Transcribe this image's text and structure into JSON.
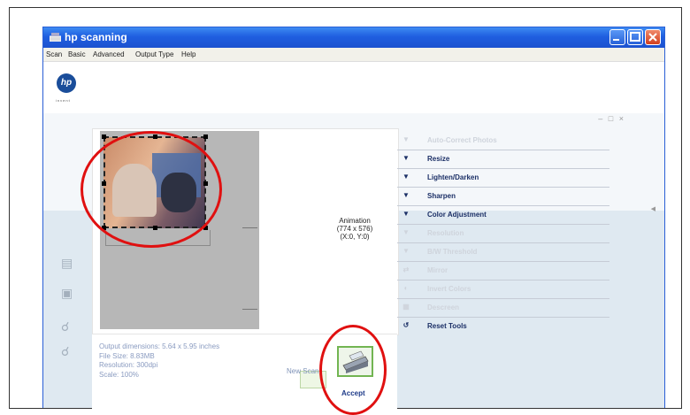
{
  "window": {
    "title": "hp scanning"
  },
  "menu": [
    "Scan",
    "Basic",
    "Advanced",
    "Output Type",
    "Help"
  ],
  "brand": {
    "logo_text": "hp",
    "logo_sub": "invent"
  },
  "panel_controls": "– □ ×",
  "preview": {
    "label_line1": "Animation",
    "label_line2": "(774 x 576)",
    "label_line3": "(X:0, Y:0)"
  },
  "tools": [
    {
      "label": "Auto-Correct Photos",
      "icon": "chevron-down-icon",
      "enabled": false
    },
    {
      "label": "Resize",
      "icon": "chevron-down-icon",
      "enabled": true
    },
    {
      "label": "Lighten/Darken",
      "icon": "chevron-down-icon",
      "enabled": true
    },
    {
      "label": "Sharpen",
      "icon": "chevron-down-icon",
      "enabled": true
    },
    {
      "label": "Color Adjustment",
      "icon": "chevron-down-icon",
      "enabled": true
    },
    {
      "label": "Resolution",
      "icon": "chevron-down-icon",
      "enabled": false
    },
    {
      "label": "B/W Threshold",
      "icon": "chevron-down-icon",
      "enabled": false
    },
    {
      "label": "Mirror",
      "icon": "mirror-icon",
      "enabled": false
    },
    {
      "label": "Invert Colors",
      "icon": "invert-icon",
      "enabled": false
    },
    {
      "label": "Descreen",
      "icon": "descreen-icon",
      "enabled": false
    },
    {
      "label": "Reset Tools",
      "icon": "reset-icon",
      "enabled": true
    }
  ],
  "info": {
    "output_dimensions": "Output dimensions: 5.64 x 5.95 inches",
    "file_size": "File Size: 8.83MB",
    "resolution": "Resolution: 300dpi",
    "scale": "Scale: 100%"
  },
  "actions": {
    "new_scan": "New Scan",
    "accept": "Accept"
  },
  "colors": {
    "title_bar": "#1f5ee0",
    "accent": "#1b2f66",
    "annotation": "#e01010"
  }
}
